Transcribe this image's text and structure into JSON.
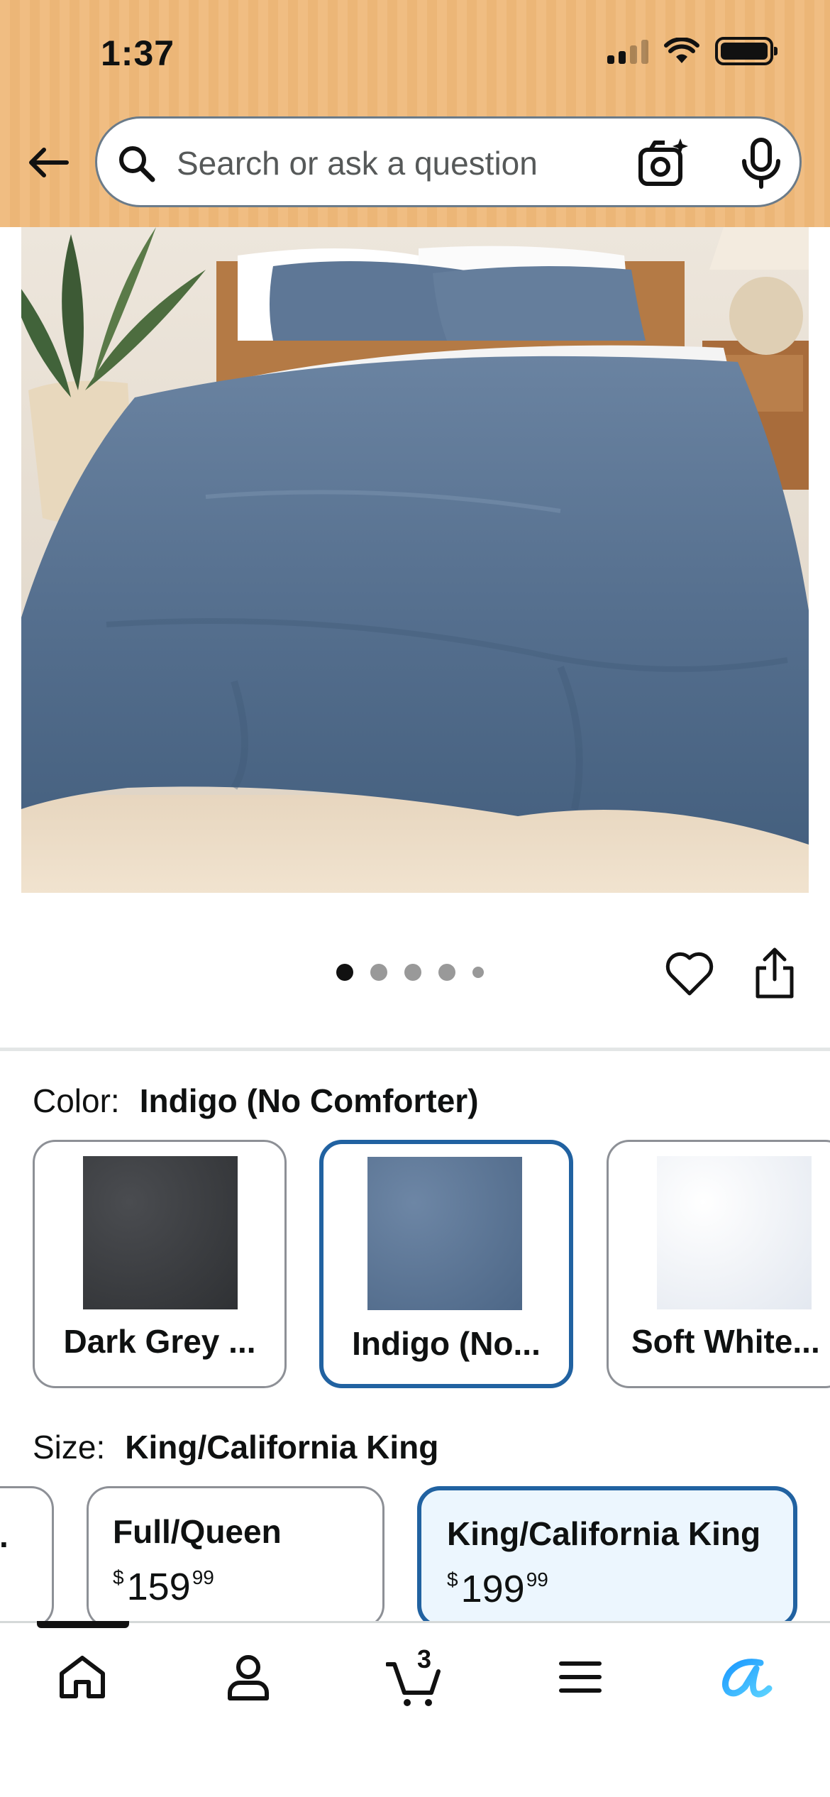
{
  "status_bar": {
    "time": "1:37"
  },
  "header": {
    "search": {
      "placeholder": "Search or ask a question"
    },
    "icons": [
      "back-arrow-icon",
      "search-icon",
      "camera-icon",
      "microphone-icon"
    ]
  },
  "gallery": {
    "image_description_icon": "bedding-product-photo",
    "page_count": 5,
    "current_page": 1
  },
  "color": {
    "label": "Color:",
    "selected": "Indigo (No Comforter)",
    "options": [
      {
        "label": "Dark Grey ...",
        "swatch": "#3b3d40"
      },
      {
        "label": "Indigo (No...",
        "swatch": "#566f8f"
      },
      {
        "label": "Soft White...",
        "swatch": "#eef1f6"
      }
    ]
  },
  "size": {
    "label": "Size:",
    "selected": "King/California King",
    "options": [
      {
        "name": "Full/Queen",
        "currency": "$",
        "dollars": "159",
        "cents": "99"
      },
      {
        "name": "King/California King",
        "currency": "$",
        "dollars": "199",
        "cents": "99"
      }
    ]
  },
  "bottom_nav": {
    "items": [
      "home-icon",
      "account-icon",
      "cart-icon",
      "menu-icon",
      "rufus-icon"
    ],
    "cart_count": "3"
  },
  "colors": {
    "header_bg": "#f0bd82",
    "selected_border": "#2162a1",
    "selected_bg": "#ecf6fe",
    "rufus_accent": "#1a98ff"
  }
}
